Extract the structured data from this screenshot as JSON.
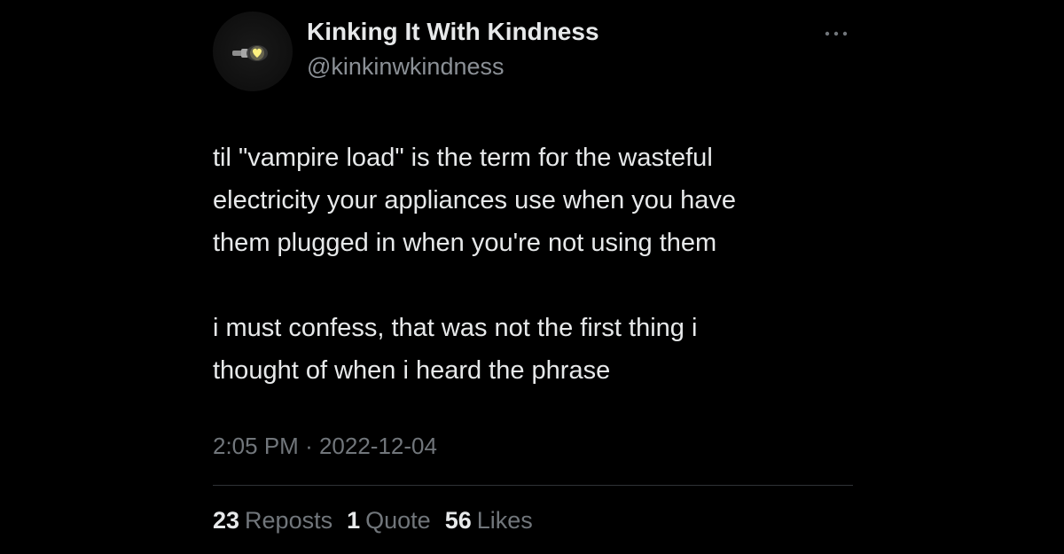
{
  "author": {
    "display_name": "Kinking It With Kindness",
    "handle": "@kinkinwkindness",
    "avatar_icon": "lightbulb-heart-icon"
  },
  "menu": {
    "icon": "more-options-icon"
  },
  "tweet": {
    "paragraphs": [
      "til \"vampire load\" is the term for the wasteful\nelectricity your appliances use when you have\nthem plugged in when you're not using them",
      "i must confess, that was not the first thing i\nthought of when i heard the phrase"
    ],
    "time": "2:05 PM",
    "separator": "·",
    "date": "2022-12-04"
  },
  "stats": {
    "reposts": {
      "count": "23",
      "label": "Reposts"
    },
    "quotes": {
      "count": "1",
      "label": "Quote"
    },
    "likes": {
      "count": "56",
      "label": "Likes"
    }
  },
  "colors": {
    "background": "#000000",
    "primary_text": "#e7e9ea",
    "secondary_text": "#71767b",
    "divider": "#2f3336",
    "avatar_glow": "#fff176"
  }
}
